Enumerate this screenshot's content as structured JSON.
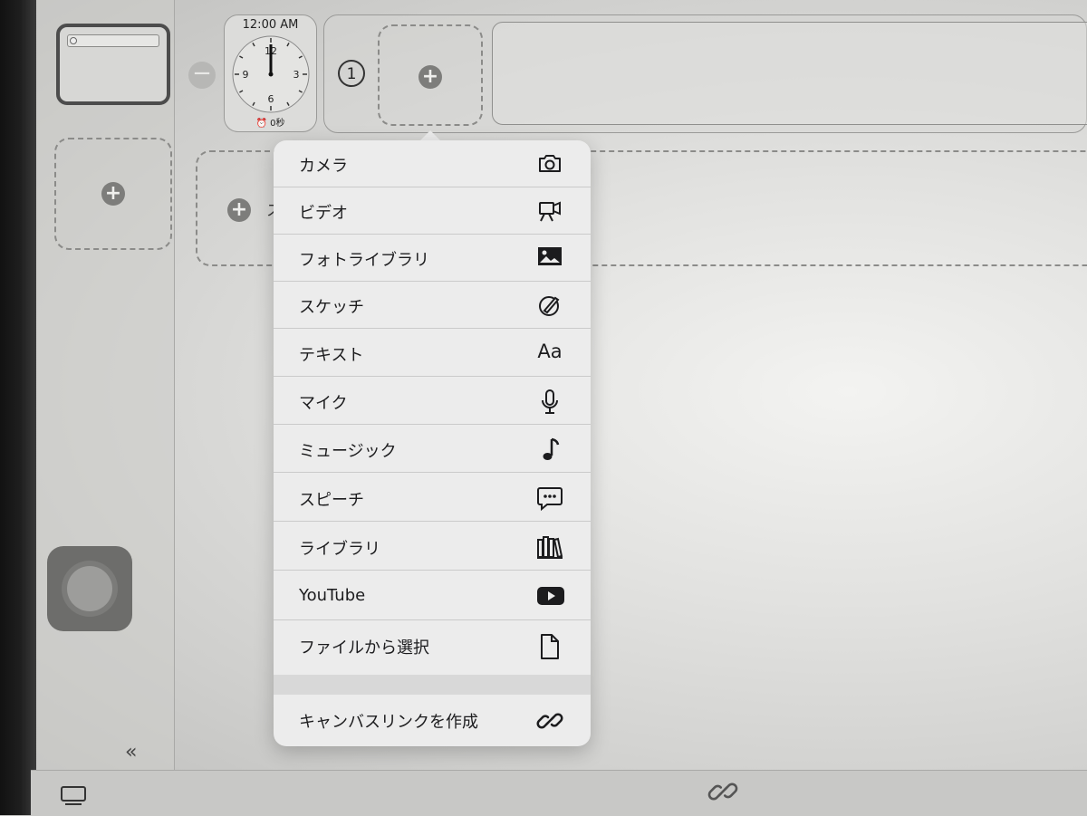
{
  "clock_widget": {
    "time": "12:00 AM",
    "numbers": [
      "12",
      "3",
      "6",
      "9"
    ],
    "alarm_text": "⏰ 0秒"
  },
  "page_indicator": "1",
  "partial_label": "ス",
  "menu": {
    "items": [
      {
        "label": "カメラ",
        "icon": "camera-icon"
      },
      {
        "label": "ビデオ",
        "icon": "video-camera-icon"
      },
      {
        "label": "フォトライブラリ",
        "icon": "photo-icon"
      },
      {
        "label": "スケッチ",
        "icon": "sketch-icon"
      },
      {
        "label": "テキスト",
        "icon": "text-icon",
        "glyph": "Aa"
      },
      {
        "label": "マイク",
        "icon": "microphone-icon"
      },
      {
        "label": "ミュージック",
        "icon": "music-note-icon"
      },
      {
        "label": "スピーチ",
        "icon": "speech-bubble-icon"
      },
      {
        "label": "ライブラリ",
        "icon": "library-books-icon"
      },
      {
        "label": "YouTube",
        "icon": "youtube-icon"
      },
      {
        "label": "ファイルから選択",
        "icon": "document-icon"
      }
    ],
    "footer": {
      "label": "キャンバスリンクを作成",
      "icon": "link-icon"
    }
  },
  "sidebar": {
    "collapse_label": "«"
  }
}
